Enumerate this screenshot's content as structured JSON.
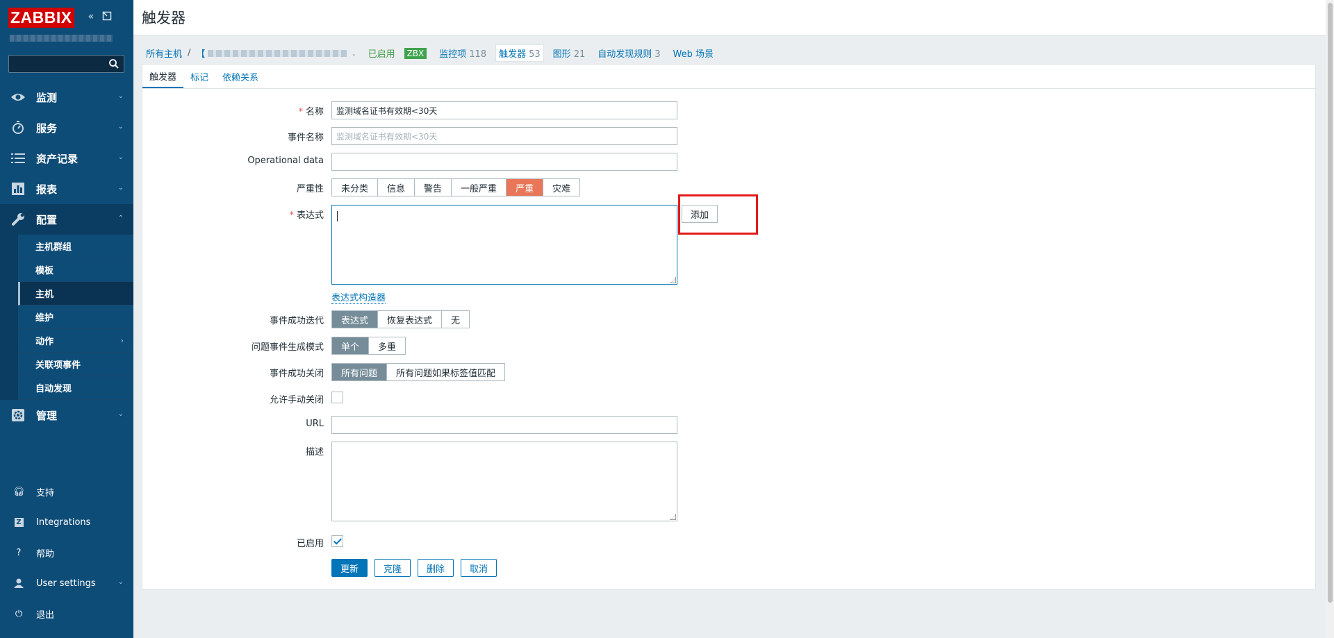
{
  "sidebar": {
    "logo": "ZABBIX",
    "search_placeholder": "",
    "menu": [
      {
        "label": "监测"
      },
      {
        "label": "服务"
      },
      {
        "label": "资产记录"
      },
      {
        "label": "报表"
      },
      {
        "label": "配置"
      },
      {
        "label": "管理"
      }
    ],
    "config_sub": [
      "主机群组",
      "模板",
      "主机",
      "维护",
      "动作",
      "关联项事件",
      "自动发现"
    ],
    "bottom": [
      "支持",
      "Integrations",
      "帮助",
      "User settings",
      "退出"
    ]
  },
  "header": {
    "title": "触发器"
  },
  "breadcrumb": {
    "all_hosts": "所有主机",
    "host_prefix": "【",
    "dot": ".",
    "enabled": "已启用",
    "zbx": "ZBX",
    "items_label": "监控项",
    "items_count": "118",
    "triggers_label": "触发器",
    "triggers_count": "53",
    "graphs_label": "图形",
    "graphs_count": "21",
    "discovery_label": "自动发现规则",
    "discovery_count": "3",
    "web_label": "Web 场景"
  },
  "tabs": [
    "触发器",
    "标记",
    "依赖关系"
  ],
  "form": {
    "name_label": "名称",
    "name_value": "监测域名证书有效期<30天",
    "event_name_label": "事件名称",
    "event_name_placeholder": "监测域名证书有效期<30天",
    "opdata_label": "Operational data",
    "severity_label": "严重性",
    "severity_options": [
      "未分类",
      "信息",
      "警告",
      "一般严重",
      "严重",
      "灾难"
    ],
    "expression_label": "表达式",
    "add_button": "添加",
    "expr_constructor": "表达式构造器",
    "ok_event_label": "事件成功迭代",
    "ok_event_options": [
      "表达式",
      "恢复表达式",
      "无"
    ],
    "gen_mode_label": "问题事件生成模式",
    "gen_mode_options": [
      "单个",
      "多重"
    ],
    "ok_close_label": "事件成功关闭",
    "ok_close_options": [
      "所有问题",
      "所有问题如果标签值匹配"
    ],
    "manual_close_label": "允许手动关闭",
    "url_label": "URL",
    "desc_label": "描述",
    "enabled_label": "已启用",
    "buttons": {
      "update": "更新",
      "clone": "克隆",
      "delete": "删除",
      "cancel": "取消"
    }
  }
}
